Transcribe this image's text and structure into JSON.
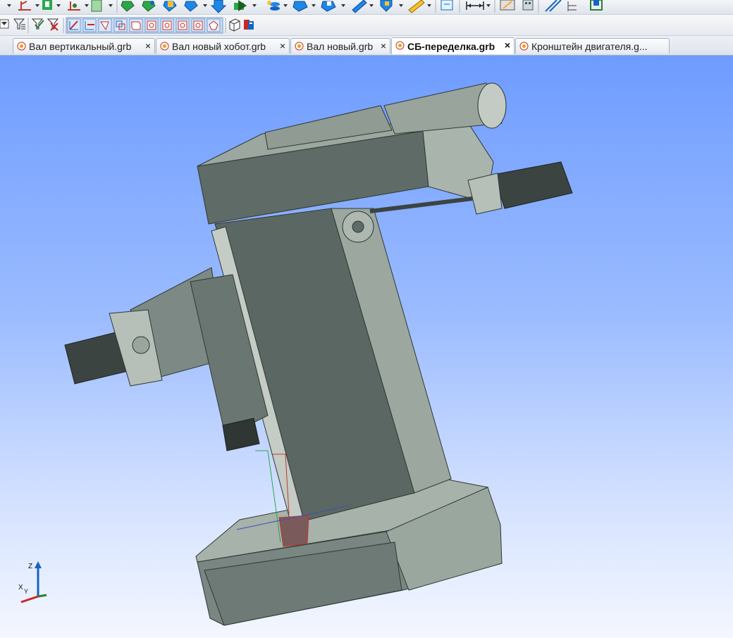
{
  "tabs": [
    {
      "label": "Вал вертикальный.grb",
      "close": "×"
    },
    {
      "label": "Вал новый хобот.grb",
      "close": "×"
    },
    {
      "label": "Вал новый.grb",
      "close": "×"
    },
    {
      "label": "СБ-переделка.grb",
      "close": "×",
      "active": true
    },
    {
      "label": "Кронштейн двигателя.g...",
      "close": "×"
    }
  ],
  "toolbar1": {
    "icons": [
      "dropdown-arrow-icon",
      "constraint-icon",
      "solid-green-icon",
      "axis-icon",
      "sheet-icon",
      "green-cube-icon",
      "green-cube-2-icon",
      "yellow-cube-icon",
      "blue-cube-icon",
      "blue-arrow-icon",
      "green-arrow-icon",
      "blue-stack-icon",
      "blue-shape-icon",
      "blue-shape-2-icon",
      "blue-pen-icon",
      "blue-shield-icon",
      "pencil-icon",
      "blue-doc-icon",
      "dimension-icon",
      "calculator-icon",
      "calc-2-icon",
      "paperclip-icon",
      "tree-icon",
      "green-square-icon"
    ]
  },
  "toolbar2": {
    "icons": [
      "filter-icon",
      "filter-list-icon",
      "check-filter-icon",
      "cross-filter-icon",
      "select-point-icon",
      "select-edge-icon",
      "select-face-icon",
      "select-body-icon",
      "select-solid-icon",
      "select-op-1-icon",
      "select-op-2-icon",
      "select-op-3-icon",
      "select-op-4-icon",
      "select-op-5-icon",
      "cube-outline-icon",
      "red-blue-doc-icon"
    ]
  },
  "axes": {
    "z": "Z",
    "x": "X",
    "y": "Y"
  },
  "colors": {
    "viewport_top": "#6e9cff",
    "viewport_bottom": "#f4f7ff",
    "body_dark": "#5d6964",
    "body_light": "#9ba79f"
  }
}
